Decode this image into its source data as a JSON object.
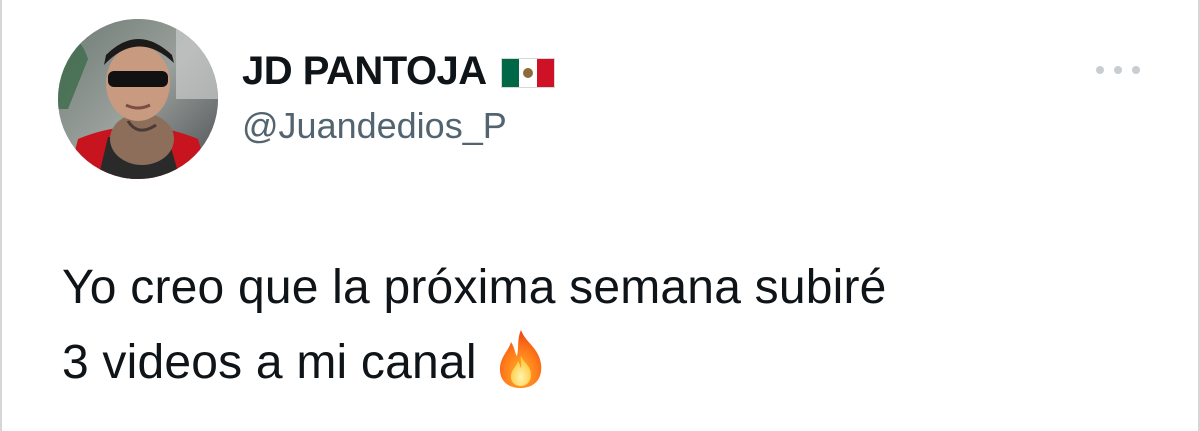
{
  "author": {
    "display_name": "JD PANTOJA",
    "flag_emoji": "mexico-flag",
    "handle": "@Juandedios_P",
    "avatar_icon": "profile-photo"
  },
  "tweet": {
    "text_line_1": "Yo creo que la próxima semana subiré",
    "text_line_2": "3 videos a mi canal",
    "emoji": "fire-icon"
  },
  "colors": {
    "text_primary": "#0f1419",
    "text_secondary": "#536471",
    "more_dots": "#c8cdd1"
  }
}
